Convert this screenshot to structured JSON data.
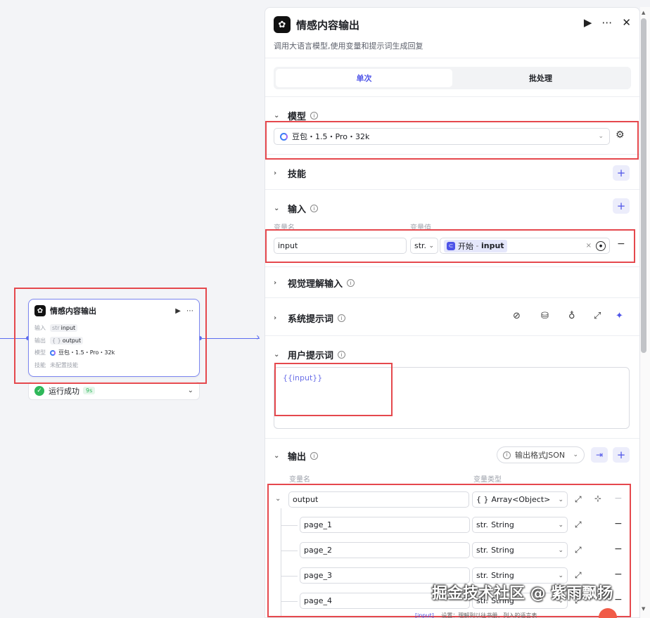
{
  "node": {
    "title": "情感内容输出",
    "input_label": "输入",
    "input_type": "str",
    "input_value": "input",
    "output_label": "输出",
    "output_type": "{ }",
    "output_value": "output",
    "model_label": "模型",
    "model_value": "豆包・1.5・Pro・32k",
    "skill_label": "技能",
    "skill_value": "未配置技能"
  },
  "run_status": {
    "label": "运行成功",
    "time": "9s"
  },
  "panel": {
    "title": "情感内容输出",
    "subtitle": "调用大语言模型,使用变量和提示词生成回复",
    "tabs": [
      {
        "label": "单次",
        "active": true
      },
      {
        "label": "批处理",
        "active": false
      }
    ]
  },
  "model_section": {
    "label": "模型",
    "selected": "豆包・1.5・Pro・32k"
  },
  "skills_section": {
    "label": "技能"
  },
  "input_section": {
    "label": "输入",
    "col_name": "变量名",
    "col_value": "变量值",
    "row": {
      "name": "input",
      "type": "str.",
      "ref_label": "开始",
      "ref_sep": " - ",
      "ref_var": "input"
    }
  },
  "vision_section": {
    "label": "视觉理解输入"
  },
  "system_prompt_section": {
    "label": "系统提示词"
  },
  "user_prompt_section": {
    "label": "用户提示词",
    "content": "{{input}}"
  },
  "output_section": {
    "label": "输出",
    "format_label": "输出格式JSON",
    "col_name": "变量名",
    "col_type": "变量类型",
    "root": {
      "name": "output",
      "type": "Array<Object>",
      "type_prefix": "{ }"
    },
    "children": [
      {
        "name": "page_1",
        "type": "String",
        "type_prefix": "str."
      },
      {
        "name": "page_2",
        "type": "String",
        "type_prefix": "str."
      },
      {
        "name": "page_3",
        "type": "String",
        "type_prefix": "str."
      },
      {
        "name": "page_4",
        "type": "String",
        "type_prefix": "str."
      }
    ]
  },
  "peek_text": {
    "tag": "[input]",
    "text": "设置：理解到以往书册，列入的语言表"
  },
  "watermark": "掘金技术社区 @ 紫雨飘扬",
  "colors": {
    "accent": "#4d53e8",
    "edge": "#5b6cf0",
    "highlight": "#e5484d",
    "success": "#2fb85a"
  },
  "icons": [
    "run-icon",
    "more-icon",
    "close-icon",
    "info-icon",
    "gear-icon",
    "plus-icon",
    "chevron-down-icon",
    "compass-icon",
    "library-icon",
    "bulb-icon",
    "expand-icon",
    "sparkle-icon",
    "import-icon",
    "add-child-icon",
    "target-icon"
  ]
}
